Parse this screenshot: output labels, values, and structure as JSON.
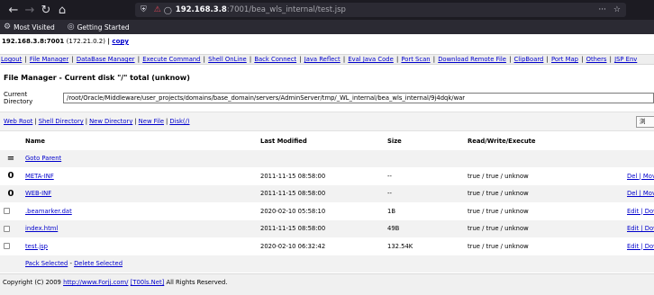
{
  "browser": {
    "url_host": "192.168.3.8",
    "url_rest": ":7001/bea_wls_internal/test.jsp",
    "bookmarks": [
      "Most Visited",
      "Getting Started"
    ],
    "icons": {
      "back": "arrow-left-icon",
      "forward": "arrow-right-icon",
      "reload": "reload-icon",
      "home": "home-icon",
      "shield": "shield-icon",
      "lock": "insecure-lock-icon",
      "key": "key-icon",
      "more": "more-dots-icon",
      "star": "bookmark-star-icon"
    }
  },
  "host": {
    "address": "192.168.3.8:7001",
    "ip": "(172.21.0.2)",
    "sep": "|",
    "copy_label": "copy"
  },
  "menu": [
    "Logout",
    "File Manager",
    "DataBase Manager",
    "Execute Command",
    "Shell OnLine",
    "Back Connect",
    "Java Reflect",
    "Eval Java Code",
    "Port Scan",
    "Download Remote File",
    "ClipBoard",
    "Port Map",
    "Others",
    "JSP Env"
  ],
  "file_manager": {
    "title": "File Manager - Current disk \"/\" total (unknow)",
    "current_dir_label": "Current Directory",
    "current_dir_value": "/root/Oracle/Middleware/user_projects/domains/base_domain/servers/AdminServer/tmp/_WL_internal/bea_wls_internal/9j4dqk/war",
    "tools": [
      "Web Root",
      "Shell Directory",
      "New Directory",
      "New File",
      "Disk(/)"
    ],
    "small_button": "浏"
  },
  "table": {
    "headers": [
      "",
      "Name",
      "Last Modified",
      "Size",
      "Read/Write/Execute",
      ""
    ],
    "parent": {
      "icon": "=",
      "name": "Goto Parent"
    },
    "rows": [
      {
        "kind": "dir",
        "icon": "0",
        "name": "META-INF",
        "modified": "2011-11-15 08:58:00",
        "size": "--",
        "rwx": "true / true / unknow",
        "actions": "Del | Mov"
      },
      {
        "kind": "dir",
        "icon": "0",
        "name": "WEB-INF",
        "modified": "2011-11-15 08:58:00",
        "size": "--",
        "rwx": "true / true / unknow",
        "actions": "Del | Mov"
      },
      {
        "kind": "file",
        "name": ".beamarker.dat",
        "modified": "2020-02-10 05:58:10",
        "size": "1B",
        "rwx": "true / true / unknow",
        "actions": "Edit | Dov"
      },
      {
        "kind": "file",
        "name": "index.html",
        "modified": "2011-11-15 08:58:00",
        "size": "49B",
        "rwx": "true / true / unknow",
        "actions": "Edit | Dov"
      },
      {
        "kind": "file",
        "name": "test.jsp",
        "modified": "2020-02-10 06:32:42",
        "size": "132.54K",
        "rwx": "true / true / unknow",
        "actions": "Edit | Dov"
      }
    ],
    "pack_selected": "Pack Selected",
    "dash": "-",
    "delete_selected": "Delete Selected"
  },
  "footer": {
    "prefix": "Copyright (C) 2009",
    "link1": "http://www.Forjj.com/",
    "link2": "[T00ls.Net]",
    "suffix": "All Rights Reserved."
  },
  "colors": {
    "link": "#0000cc",
    "chrome_bg": "#1c1b22",
    "toolbar_bg": "#2b2a33",
    "row_alt": "#f2f2f2"
  }
}
